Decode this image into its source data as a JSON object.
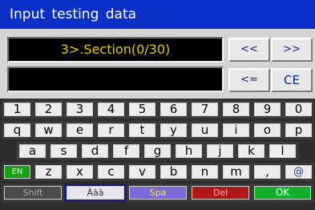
{
  "title": "Input testing data",
  "section_label": "3>.Section(0/30)",
  "input_value": "",
  "buttons": {
    "prev": "<<",
    "next": ">>",
    "backspace": "<=",
    "clear": "CE"
  },
  "keyboard": {
    "row1": [
      "1",
      "2",
      "3",
      "4",
      "5",
      "6",
      "7",
      "8",
      "9",
      "0"
    ],
    "row2": [
      "q",
      "w",
      "e",
      "r",
      "t",
      "y",
      "u",
      "i",
      "o",
      "p"
    ],
    "row3": [
      "a",
      "s",
      "d",
      "f",
      "g",
      "h",
      "j",
      "k",
      "l"
    ],
    "row4": [
      "EN",
      "z",
      "x",
      "c",
      "v",
      "b",
      "n",
      "m",
      ",",
      "@"
    ],
    "row5": [
      "Shift",
      "Ààà",
      "Spa",
      "Del",
      "OK"
    ]
  }
}
